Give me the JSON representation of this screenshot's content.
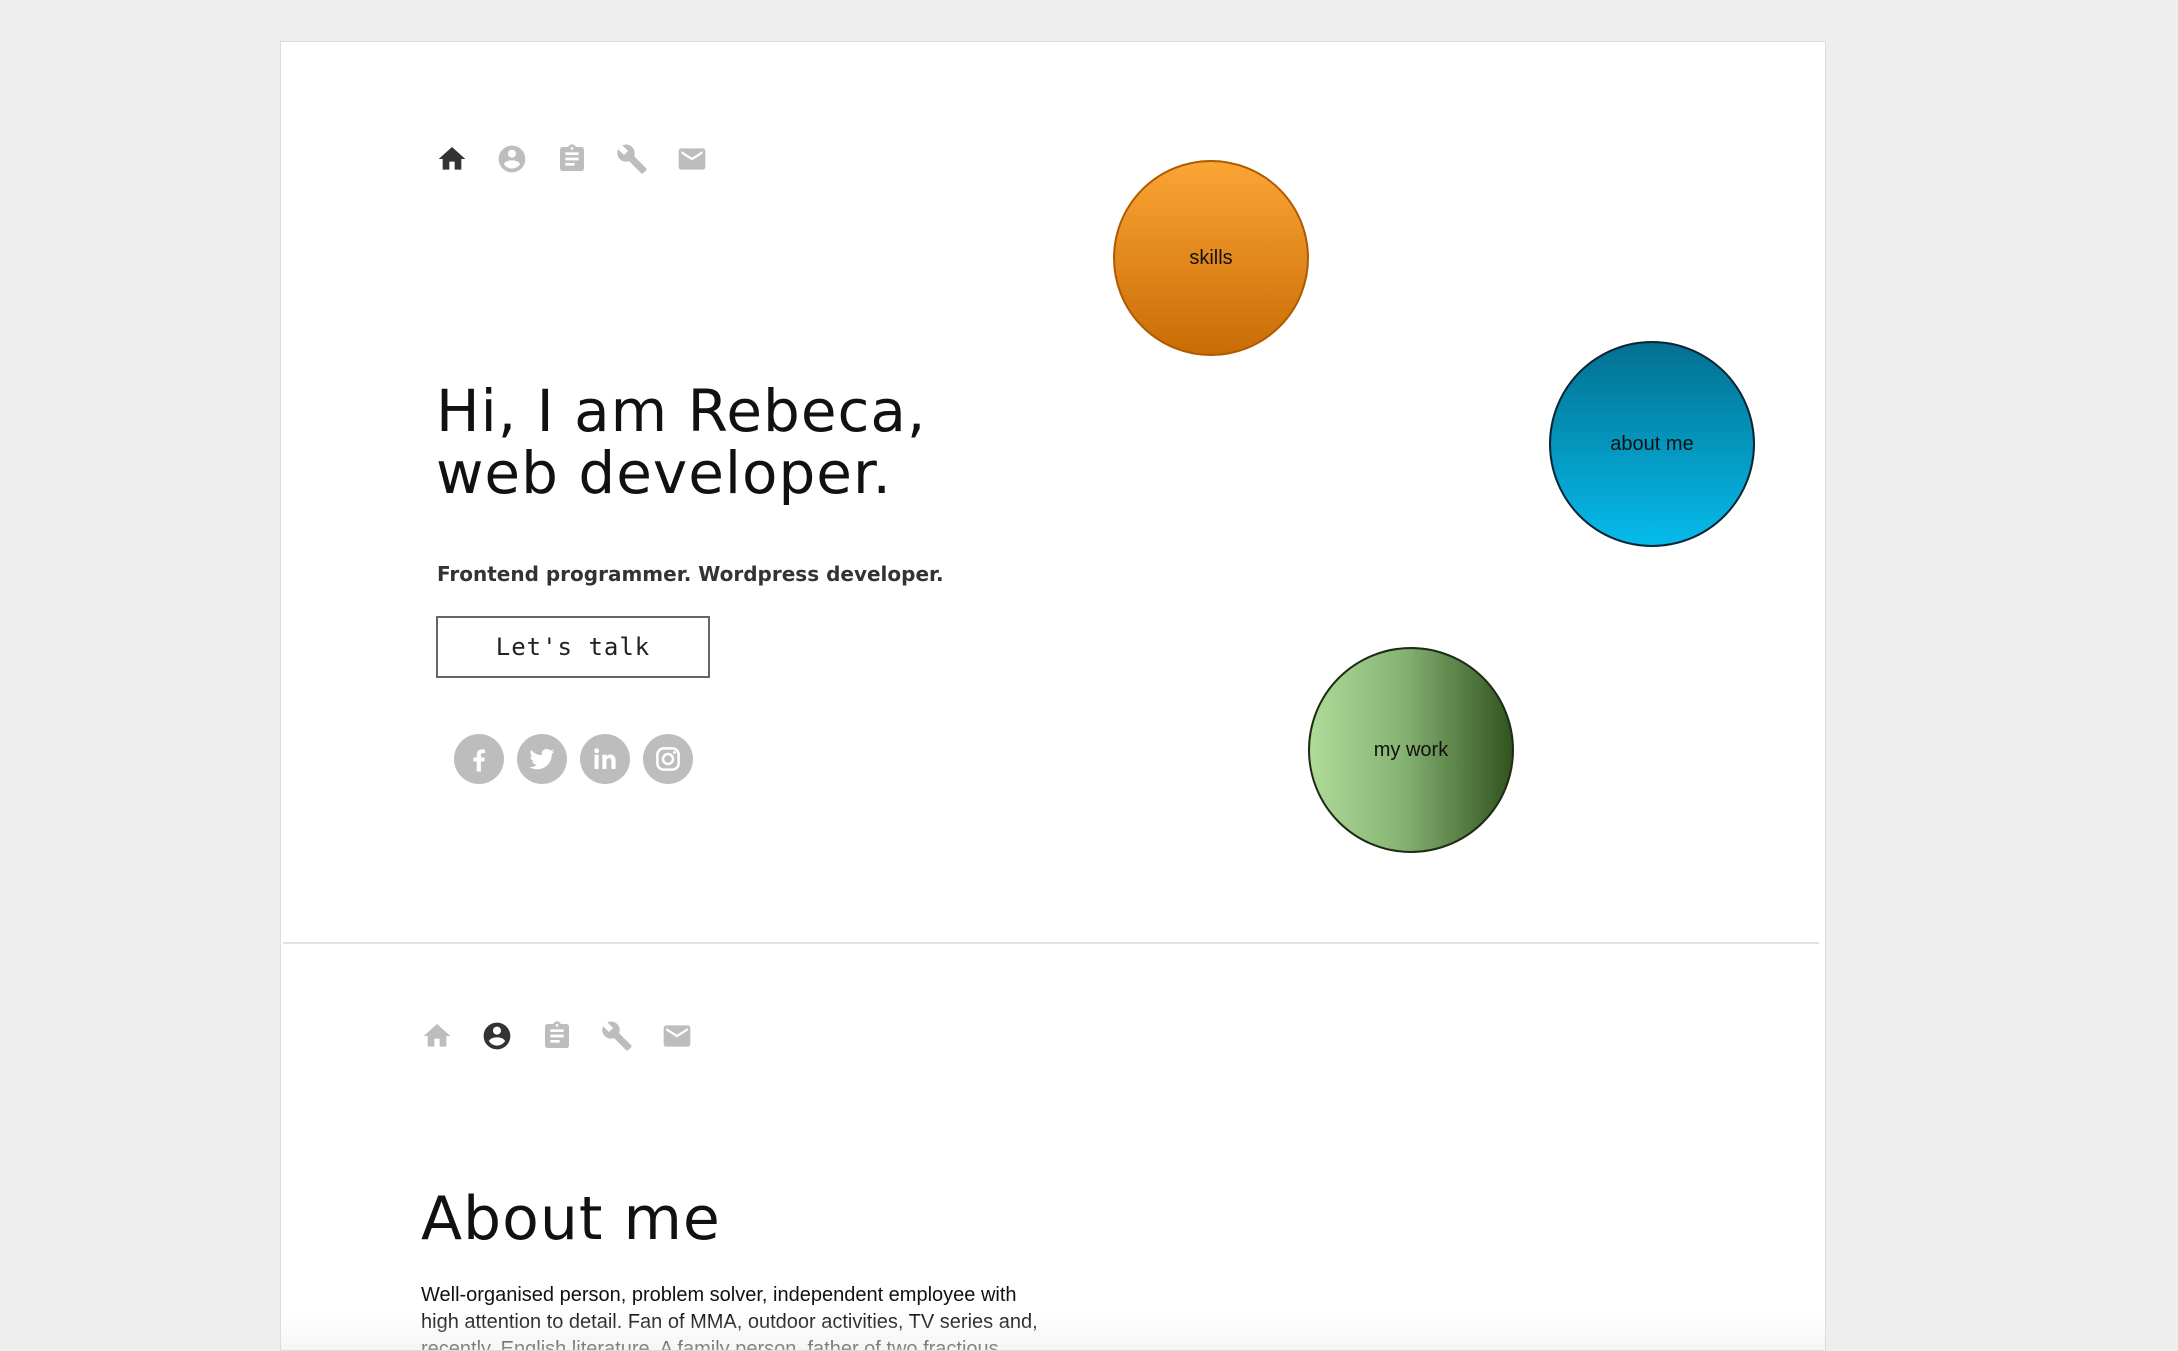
{
  "hero": {
    "nav": [
      {
        "icon": "home-icon",
        "active": true
      },
      {
        "icon": "account-icon",
        "active": false
      },
      {
        "icon": "clipboard-icon",
        "active": false
      },
      {
        "icon": "wrench-icon",
        "active": false
      },
      {
        "icon": "mail-icon",
        "active": false
      }
    ],
    "title_line1": "Hi, I am Rebeca,",
    "title_line2": "web developer.",
    "subtitle": "Frontend programmer. Wordpress developer.",
    "cta_label": "Let's talk",
    "social": [
      "facebook-icon",
      "twitter-icon",
      "linkedin-icon",
      "instagram-icon"
    ],
    "bubbles": {
      "skills": "skills",
      "about": "about me",
      "work": "my work"
    }
  },
  "about": {
    "nav": [
      {
        "icon": "home-icon",
        "active": false
      },
      {
        "icon": "account-icon",
        "active": true
      },
      {
        "icon": "clipboard-icon",
        "active": false
      },
      {
        "icon": "wrench-icon",
        "active": false
      },
      {
        "icon": "mail-icon",
        "active": false
      }
    ],
    "title": "About me",
    "text": "Well-organised person, problem solver, independent employee with high attention to detail. Fan of MMA, outdoor activities, TV series and, recently, English literature. A family person, father of two fractious boys, therefore remote employment is preferred."
  },
  "colors": {
    "nav_active": "#333333",
    "nav_inactive": "#bdbdbd",
    "skills_top": "#fba535",
    "skills_bottom": "#c96c05",
    "about_top": "#047090",
    "about_bottom": "#05bbea",
    "work_left": "#aedb98",
    "work_right": "#32531f"
  }
}
